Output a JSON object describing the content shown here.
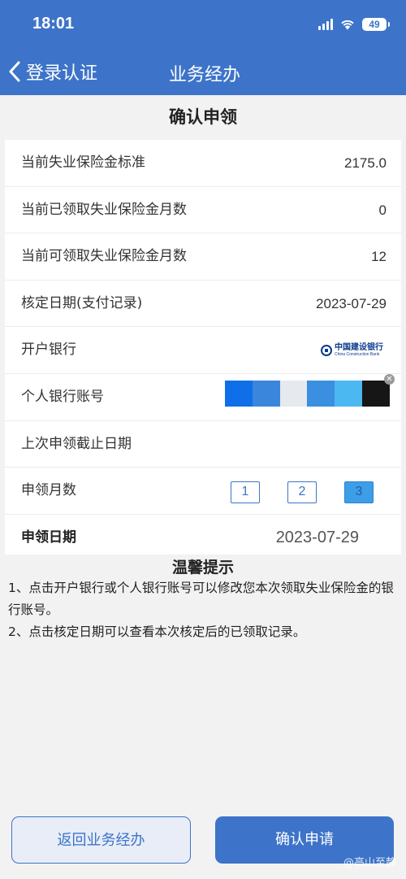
{
  "status_bar": {
    "time": "18:01",
    "battery": "49"
  },
  "nav": {
    "back_label": "登录认证",
    "title": "业务经办"
  },
  "page_title": "确认申领",
  "rows": {
    "standard": {
      "label": "当前失业保险金标准",
      "value": "2175.0"
    },
    "received_months": {
      "label": "当前已领取失业保险金月数",
      "value": "0"
    },
    "available_months": {
      "label": "当前可领取失业保险金月数",
      "value": "12"
    },
    "verify_date": {
      "label": "核定日期(支付记录)",
      "value": "2023-07-29"
    },
    "bank": {
      "label": "开户银行",
      "logo_cn": "中国建设银行",
      "logo_en": "China Construction Bank"
    },
    "account": {
      "label": "个人银行账号",
      "mosaic_colors": [
        "#0f6fe8",
        "#3a86dc",
        "#e6e9ee",
        "#3b8fe0",
        "#4bb8f2",
        "#161616"
      ]
    },
    "last_deadline": {
      "label": "上次申领截止日期",
      "value": ""
    },
    "apply_months": {
      "label": "申领月数",
      "options": [
        "1",
        "2",
        "3"
      ],
      "selected": "3"
    },
    "apply_date": {
      "label": "申领日期",
      "value": "2023-07-29"
    }
  },
  "tips": {
    "title": "温馨提示",
    "items": [
      "1、点击开户银行或个人银行账号可以修改您本次领取失业保险金的银行账号。",
      "2、点击核定日期可以查看本次核定后的已领取记录。"
    ]
  },
  "buttons": {
    "back": "返回业务经办",
    "confirm": "确认申请"
  },
  "watermark": "@高山至静",
  "colors": {
    "primary": "#3d74c9",
    "background": "#f2f2f2"
  }
}
